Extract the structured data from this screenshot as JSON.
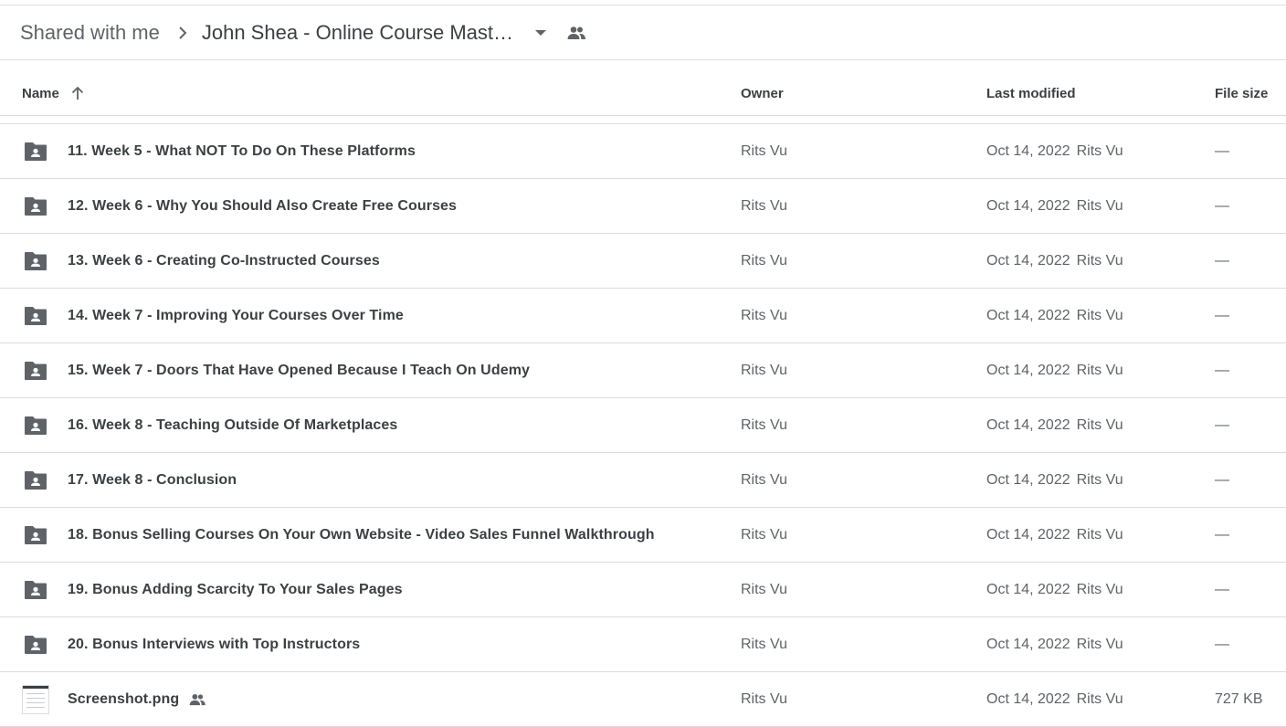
{
  "breadcrumb": {
    "root": "Shared with me",
    "current": "John Shea - Online Course Mastery"
  },
  "columns": {
    "name": "Name",
    "owner": "Owner",
    "last_modified": "Last modified",
    "file_size": "File size"
  },
  "sort": {
    "column": "Name",
    "direction": "ascending"
  },
  "files": [
    {
      "icon": "shared-folder-icon",
      "name": "11. Week 5 - What NOT To Do On These Platforms",
      "owner": "Rits Vu",
      "modified_date": "Oct 14, 2022",
      "modified_by": "Rits Vu",
      "size": "—"
    },
    {
      "icon": "shared-folder-icon",
      "name": "12. Week 6 - Why You Should Also Create Free Courses",
      "owner": "Rits Vu",
      "modified_date": "Oct 14, 2022",
      "modified_by": "Rits Vu",
      "size": "—"
    },
    {
      "icon": "shared-folder-icon",
      "name": "13. Week 6 - Creating Co-Instructed Courses",
      "owner": "Rits Vu",
      "modified_date": "Oct 14, 2022",
      "modified_by": "Rits Vu",
      "size": "—"
    },
    {
      "icon": "shared-folder-icon",
      "name": "14. Week 7 - Improving Your Courses Over Time",
      "owner": "Rits Vu",
      "modified_date": "Oct 14, 2022",
      "modified_by": "Rits Vu",
      "size": "—"
    },
    {
      "icon": "shared-folder-icon",
      "name": "15. Week 7 - Doors That Have Opened Because I Teach On Udemy",
      "owner": "Rits Vu",
      "modified_date": "Oct 14, 2022",
      "modified_by": "Rits Vu",
      "size": "—"
    },
    {
      "icon": "shared-folder-icon",
      "name": "16. Week 8 - Teaching Outside Of Marketplaces",
      "owner": "Rits Vu",
      "modified_date": "Oct 14, 2022",
      "modified_by": "Rits Vu",
      "size": "—"
    },
    {
      "icon": "shared-folder-icon",
      "name": "17. Week 8 - Conclusion",
      "owner": "Rits Vu",
      "modified_date": "Oct 14, 2022",
      "modified_by": "Rits Vu",
      "size": "—"
    },
    {
      "icon": "shared-folder-icon",
      "name": "18. Bonus Selling Courses On Your Own Website - Video Sales Funnel Walkthrough",
      "owner": "Rits Vu",
      "modified_date": "Oct 14, 2022",
      "modified_by": "Rits Vu",
      "size": "—"
    },
    {
      "icon": "shared-folder-icon",
      "name": "19. Bonus Adding Scarcity To Your Sales Pages",
      "owner": "Rits Vu",
      "modified_date": "Oct 14, 2022",
      "modified_by": "Rits Vu",
      "size": "—"
    },
    {
      "icon": "shared-folder-icon",
      "name": "20. Bonus Interviews with Top Instructors",
      "owner": "Rits Vu",
      "modified_date": "Oct 14, 2022",
      "modified_by": "Rits Vu",
      "size": "—"
    },
    {
      "icon": "image-thumbnail",
      "name": "Screenshot.png",
      "shared": true,
      "owner": "Rits Vu",
      "modified_date": "Oct 14, 2022",
      "modified_by": "Rits Vu",
      "size": "727 KB"
    }
  ],
  "colors": {
    "text_primary": "#3c4043",
    "text_secondary": "#5f6368",
    "icon": "#5f6368",
    "divider": "#dadce0"
  }
}
